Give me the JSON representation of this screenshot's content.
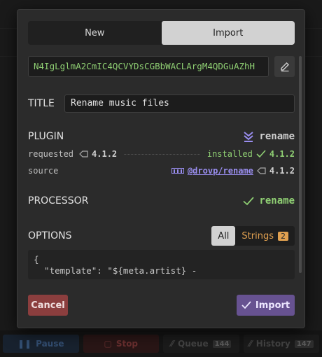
{
  "tabs": [
    {
      "label": "New",
      "active": false
    },
    {
      "label": "Import",
      "active": true
    }
  ],
  "import_code": "N4IgLglmA2CmIC4QCVYDsCGBbWACLArgM4QDGuAZhH",
  "title": {
    "label": "TITLE",
    "value": "Rename music files"
  },
  "plugin": {
    "label": "PLUGIN",
    "name": "rename",
    "requested_label": "requested",
    "requested_version": "4.1.2",
    "installed_label": "installed",
    "installed_version": "4.1.2",
    "source_label": "source",
    "source_name": "@drovp/rename",
    "source_version": "4.1.2"
  },
  "processor": {
    "label": "PROCESSOR",
    "name": "rename"
  },
  "options": {
    "label": "OPTIONS",
    "all_label": "All",
    "strings_label": "Strings",
    "strings_count": "2",
    "json_preview": "{\n  \"template\": \"${meta.artist} -"
  },
  "buttons": {
    "cancel": "Cancel",
    "import": "Import"
  },
  "background_bar": {
    "pause": "Pause",
    "stop": "Stop",
    "queue": "Queue",
    "queue_count": "144",
    "history": "History",
    "history_count": "147"
  },
  "colors": {
    "accent_green": "#8fcf73",
    "link_purple": "#9a8ef0",
    "cancel_red": "#8b3e3e",
    "import_purple": "#675291",
    "strings_orange": "#e0a050"
  }
}
